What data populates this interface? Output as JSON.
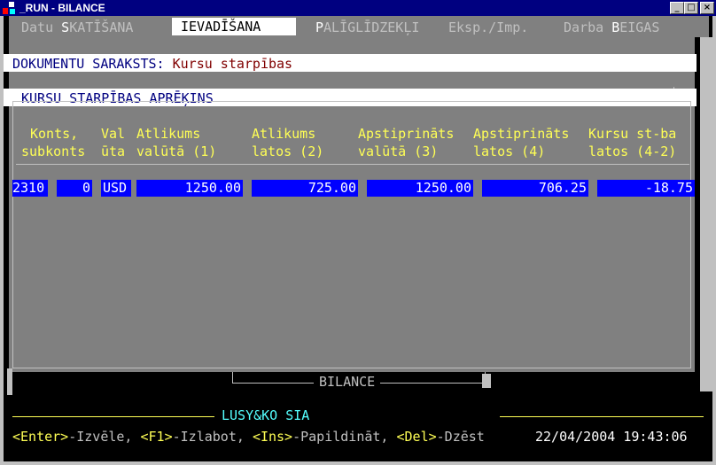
{
  "window": {
    "title": "_RUN - BILANCE",
    "buttons": {
      "minimize": "_",
      "maximize": "□",
      "close": "×"
    }
  },
  "menu": [
    {
      "pre": "Datu ",
      "hot": "S",
      "post": "KATĪŠANA",
      "active": false
    },
    {
      "pre": "",
      "hot": "I",
      "post": "EVADĪŠANA",
      "active": true
    },
    {
      "pre": "",
      "hot": "P",
      "post": "ALĪGLĪDZEKĻI",
      "active": false
    },
    {
      "pre": "Eksp./Imp.",
      "hot": "",
      "post": "",
      "active": false
    },
    {
      "pre": "Darba ",
      "hot": "B",
      "post": "EIGAS",
      "active": false
    }
  ],
  "doc_list": {
    "label": "DOKUMENTU SARAKSTS:",
    "value": "Kursu starpības"
  },
  "section_title": "KURSU STARPĪBAS APRĒĶINS",
  "table": {
    "headers": [
      {
        "line1": "Konts,",
        "line2": "subkonts"
      },
      {
        "line1": "Val",
        "line2": "ūta"
      },
      {
        "line1": "Atlikums",
        "line2": "valūtā (1)"
      },
      {
        "line1": "Atlikums",
        "line2": "latos (2)"
      },
      {
        "line1": "Apstiprināts",
        "line2": "valūtā (3)"
      },
      {
        "line1": "Apstiprināts",
        "line2": "latos (4)"
      },
      {
        "line1": "Kursu st-ba",
        "line2": "latos (4-2)"
      }
    ],
    "row": {
      "account": "2310",
      "subaccount": "0",
      "currency": "USD",
      "balance_currency": "1250.00",
      "balance_lats": "725.00",
      "approved_currency": "1250.00",
      "approved_lats": "706.25",
      "rate_difference": "-18.75"
    }
  },
  "frame_title": "BILANCE",
  "footer": {
    "company": "LUSY&KO SIA",
    "hints": [
      {
        "key": "<Enter>",
        "text": "-Izvēle, "
      },
      {
        "key": "<F1>",
        "text": "-Izlabot, "
      },
      {
        "key": "<Ins>",
        "text": "-Papildināt, "
      },
      {
        "key": "<Del>",
        "text": "-Dzēst"
      }
    ],
    "datetime": "22/04/2004 19:43:06"
  },
  "colors": {
    "titlebar": "#000080",
    "panel": "#808080",
    "header_text": "#ffff55",
    "cell_bg": "#0000ff",
    "company": "#55ffff"
  }
}
